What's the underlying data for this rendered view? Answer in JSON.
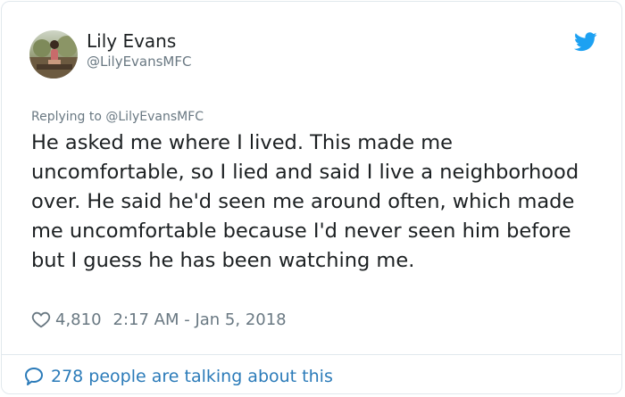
{
  "user": {
    "display_name": "Lily Evans",
    "handle": "@LilyEvansMFC",
    "avatar_icon": "profile-photo"
  },
  "brand": {
    "logo_icon": "twitter-bird-icon",
    "accent_color": "#1da1f2",
    "link_color": "#2b7bb9",
    "text_color": "#1c2022",
    "muted_color": "#697882"
  },
  "tweet": {
    "replying_to": "Replying to @LilyEvansMFC",
    "text": "He asked me where I lived. This made me uncomfortable, so I lied and said I live a neighborhood over. He said he'd seen me around often, which made me uncomfortable because I'd never seen him before but I guess he has been watching me.",
    "likes": "4,810",
    "timestamp": "2:17 AM - Jan 5, 2018"
  },
  "footer": {
    "conversation_label": "278 people are talking about this"
  }
}
